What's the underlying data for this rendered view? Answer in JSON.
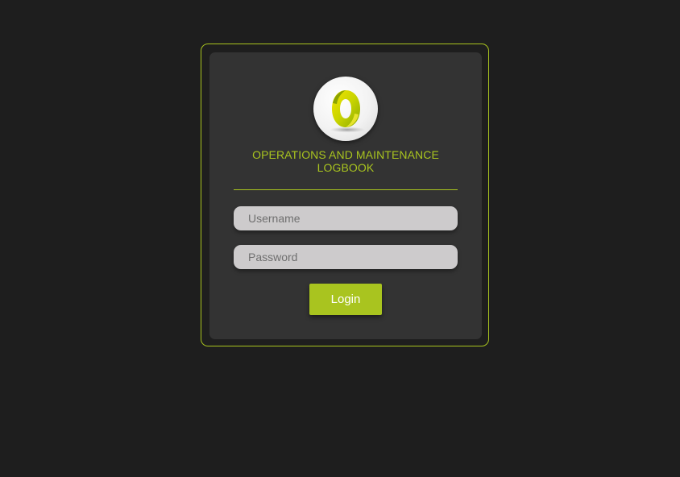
{
  "login_card": {
    "logo_icon": "stylized-o-logo-icon",
    "title_line1": "OPERATIONS AND MAINTENANCE",
    "title_line2": "LOGBOOK",
    "username": {
      "value": "",
      "placeholder": "Username"
    },
    "password": {
      "value": "",
      "placeholder": "Password"
    },
    "login_label": "Login"
  },
  "colors": {
    "accent": "#a9c41f",
    "background": "#1e1e1e",
    "card": "#333333",
    "input": "#cdcbcc"
  }
}
